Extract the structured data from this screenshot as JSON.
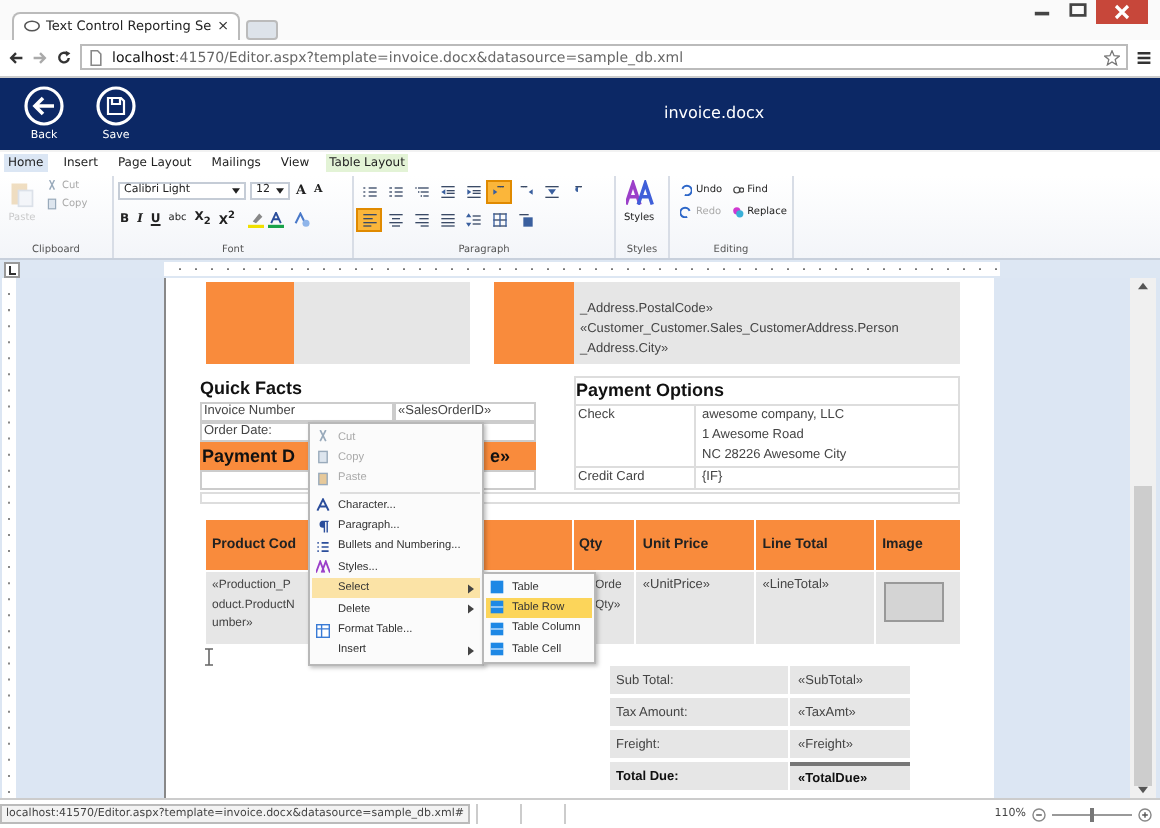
{
  "browser": {
    "tab_title": "Text Control Reporting Se",
    "tab_close": "×",
    "url_host": "localhost",
    "url_rest": ":41570/Editor.aspx?template=invoice.docx&datasource=sample_db.xml"
  },
  "app_bar": {
    "buttons": [
      {
        "label": "Back",
        "kind": "back"
      },
      {
        "label": "Save",
        "kind": "save"
      }
    ],
    "title": "invoice.docx"
  },
  "ribbon_tabs": [
    {
      "label": "Home",
      "selected": true,
      "contextual": false
    },
    {
      "label": "Insert",
      "selected": false,
      "contextual": false
    },
    {
      "label": "Page Layout",
      "selected": false,
      "contextual": false
    },
    {
      "label": "Mailings",
      "selected": false,
      "contextual": false
    },
    {
      "label": "View",
      "selected": false,
      "contextual": false
    },
    {
      "label": "Table Layout",
      "selected": false,
      "contextual": true
    }
  ],
  "clipboard": {
    "group": "Clipboard",
    "paste": {
      "label": "Paste",
      "disabled": true
    },
    "items": [
      {
        "label": "Cut",
        "kind": "cut",
        "disabled": true
      },
      {
        "label": "Copy",
        "kind": "copy",
        "disabled": true
      }
    ]
  },
  "font": {
    "group": "Font",
    "family": "Calibri Light",
    "size": "12",
    "size_buttons": [
      {
        "label": "A",
        "kind": "grow"
      },
      {
        "label": "A",
        "kind": "shrink"
      }
    ],
    "format_buttons": [
      "B",
      "I",
      "U",
      "abc",
      "X$_{2}$",
      "X$^{2}$"
    ]
  },
  "paragraph": {
    "group": "Paragraph",
    "rows": [
      [
        {
          "kind": "bullets",
          "selected": false
        },
        {
          "kind": "numbering",
          "selected": false
        },
        {
          "kind": "multilevel",
          "selected": false
        },
        {
          "kind": "outdent",
          "selected": false
        },
        {
          "kind": "indent",
          "selected": false
        },
        {
          "kind": "ltr",
          "selected": true
        },
        {
          "kind": "rtl",
          "selected": false
        },
        {
          "kind": "frame",
          "selected": false
        },
        {
          "kind": "marks",
          "selected": false
        }
      ],
      [
        {
          "kind": "align-left",
          "selected": true
        },
        {
          "kind": "align-center",
          "selected": false
        },
        {
          "kind": "align-right",
          "selected": false
        },
        {
          "kind": "justify",
          "selected": false
        },
        {
          "kind": "spacing",
          "selected": false
        },
        {
          "kind": "borders",
          "selected": false
        },
        {
          "kind": "shading",
          "selected": false
        }
      ]
    ]
  },
  "styles": {
    "group": "Styles",
    "label": "Styles"
  },
  "editing": {
    "group": "Editing",
    "items": [
      {
        "label": "Undo",
        "kind": "undo",
        "disabled": false
      },
      {
        "label": "Find",
        "kind": "find",
        "disabled": false
      },
      {
        "label": "Redo",
        "kind": "redo",
        "disabled": true
      },
      {
        "label": "Replace",
        "kind": "replace",
        "disabled": false
      }
    ]
  },
  "document": {
    "address_lines": [
      "_Address.PostalCode»",
      "«Customer_Customer.Sales_CustomerAddress.Person",
      "_Address.City»"
    ],
    "quick_facts": {
      "title": "Quick Facts",
      "rows": [
        {
          "label": "Invoice Number",
          "value": "«SalesOrderID»"
        },
        {
          "label": "Order Date:",
          "value": ""
        }
      ],
      "due_left": "Payment D",
      "due_right": "e»"
    },
    "payment_options": {
      "title": "Payment Options",
      "rows": [
        {
          "label": "Check",
          "lines": [
            "awesome company, LLC",
            "1 Awesome Road",
            "NC 28226 Awesome City"
          ]
        },
        {
          "label": "Credit Card",
          "lines": [
            "{IF}"
          ]
        }
      ]
    },
    "product_table": {
      "columns": [
        "Product Cod",
        "Qty",
        "Unit Price",
        "Line Total",
        "Image"
      ],
      "code_lines": [
        "«Production_P",
        "oduct.ProductN",
        "umber»"
      ],
      "qty_lines": [
        "Orde",
        "Qty»"
      ],
      "unit_price": "«UnitPrice»",
      "line_total": "«LineTotal»"
    },
    "totals": [
      {
        "label": "Sub Total:",
        "value": "«SubTotal»",
        "bold": false
      },
      {
        "label": "Tax Amount:",
        "value": "«TaxAmt»",
        "bold": false
      },
      {
        "label": "Freight:",
        "value": "«Freight»",
        "bold": false
      },
      {
        "label": "Total Due:",
        "value": "«TotalDue»",
        "bold": true
      }
    ]
  },
  "context_menu": {
    "items": [
      {
        "label": "Cut",
        "kind": "cut",
        "disabled": true,
        "selected": false,
        "submenu": false
      },
      {
        "label": "Copy",
        "kind": "copy",
        "disabled": true,
        "selected": false,
        "submenu": false
      },
      {
        "label": "Paste",
        "kind": "paste",
        "disabled": true,
        "selected": false,
        "submenu": false
      },
      {
        "label": "Character...",
        "kind": "character",
        "disabled": false,
        "selected": false,
        "submenu": false
      },
      {
        "label": "Paragraph...",
        "kind": "paragraph",
        "disabled": false,
        "selected": false,
        "submenu": false
      },
      {
        "label": "Bullets and Numbering...",
        "kind": "bullets",
        "disabled": false,
        "selected": false,
        "submenu": false
      },
      {
        "label": "Styles...",
        "kind": "styles",
        "disabled": false,
        "selected": false,
        "submenu": false
      },
      {
        "label": "Select",
        "kind": "none",
        "disabled": false,
        "selected": true,
        "submenu": true
      },
      {
        "label": "Delete",
        "kind": "none",
        "disabled": false,
        "selected": false,
        "submenu": true
      },
      {
        "label": "Format Table...",
        "kind": "format",
        "disabled": false,
        "selected": false,
        "submenu": false
      },
      {
        "label": "Insert",
        "kind": "none",
        "disabled": false,
        "selected": false,
        "submenu": true
      }
    ]
  },
  "submenu": {
    "items": [
      {
        "label": "Table",
        "selected": false
      },
      {
        "label": "Table Row",
        "selected": true
      },
      {
        "label": "Table Column",
        "selected": false
      },
      {
        "label": "Table Cell",
        "selected": false
      }
    ]
  },
  "status_bar": {
    "url": "localhost:41570/Editor.aspx?template=invoice.docx&datasource=sample_db.xml#",
    "zoom": "110%",
    "zoom_slider": {
      "level": 0.5
    }
  }
}
